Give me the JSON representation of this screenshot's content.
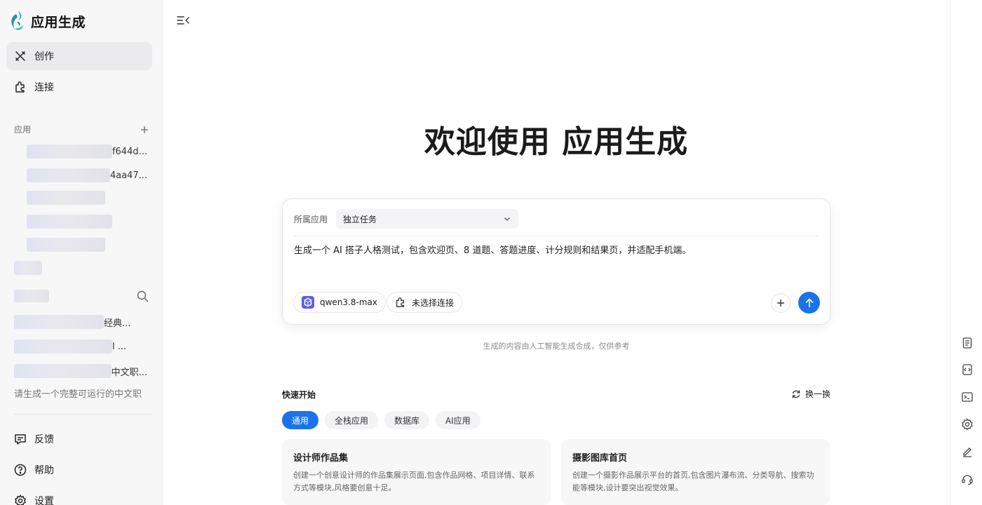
{
  "brand": {
    "title": "应用生成",
    "accent": "#1a73e8"
  },
  "nav": {
    "create": "创作",
    "connect": "连接"
  },
  "apps_section": {
    "title": "应用",
    "items": [
      {
        "label": "f644d..."
      },
      {
        "label": "4aa47..."
      },
      {
        "label": ""
      },
      {
        "label": ""
      },
      {
        "label": ""
      }
    ]
  },
  "history_section": {
    "items": [
      {
        "label": "经典..."
      },
      {
        "label": "l ..."
      },
      {
        "label": "中文职..."
      },
      {
        "label": "请生成一个完整可运行的中文职"
      }
    ]
  },
  "footer_nav": {
    "feedback": "反馈",
    "help": "帮助",
    "settings": "设置"
  },
  "main": {
    "welcome": "欢迎使用 应用生成",
    "composer": {
      "app_label": "所属应用",
      "app_value": "独立任务",
      "prompt": "生成一个 AI 搭子人格测试，包含欢迎页、8 道题、答题进度、计分规则和结果页，并适配手机端。",
      "model": "qwen3.8-max",
      "connection": "未选择连接"
    },
    "disclaimer": "生成的内容由人工智能生成合成，仅供参考",
    "quick_start": {
      "title": "快速开始",
      "refresh": "换一换",
      "tabs": [
        "通用",
        "全栈应用",
        "数据库",
        "AI应用"
      ],
      "cards": [
        {
          "title": "设计师作品集",
          "desc": "创建一个创意设计师的作品集展示页面,包含作品网格、项目详情、联系方式等模块,风格要创意十足。"
        },
        {
          "title": "摄影图库首页",
          "desc": "创建一个摄影作品展示平台的首页,包含图片瀑布流、分类导航、搜索功能等模块,设计要突出视觉效果。"
        }
      ]
    }
  },
  "icons": [
    "logo-icon",
    "create-icon",
    "connect-icon",
    "add-icon",
    "search-icon",
    "feedback-icon",
    "help-icon",
    "settings-icon",
    "sidebar-toggle-icon",
    "chevron-down-icon",
    "model-icon",
    "plug-icon",
    "send-icon",
    "refresh-icon",
    "document-icon",
    "code-icon",
    "terminal-icon",
    "gear-icon",
    "edit-icon",
    "support-icon"
  ]
}
